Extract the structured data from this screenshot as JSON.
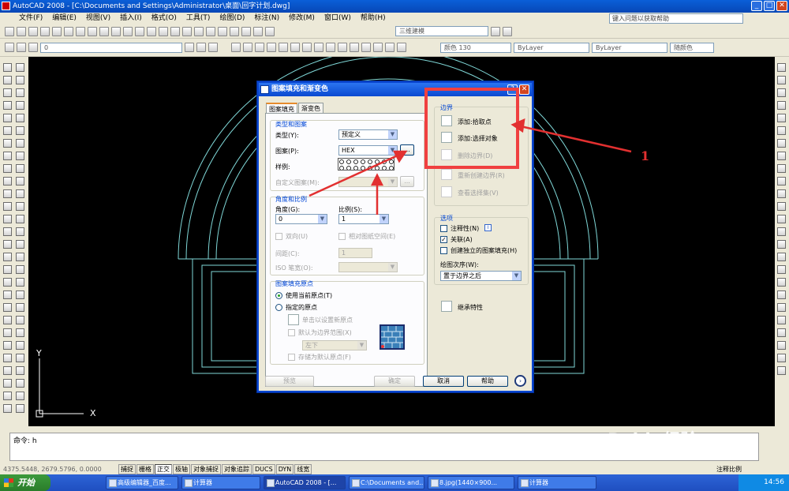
{
  "app": {
    "title": "AutoCAD 2008 - [C:\\Documents and Settings\\Administrator\\桌面\\回字计划.dwg]"
  },
  "menu": [
    "文件(F)",
    "编辑(E)",
    "视图(V)",
    "插入(I)",
    "格式(O)",
    "工具(T)",
    "绘图(D)",
    "标注(N)",
    "修改(M)",
    "窗口(W)",
    "帮助(H)"
  ],
  "help_search": {
    "placeholder": "键入问题以获取帮助"
  },
  "toolbar": {
    "workspace": "三维建模",
    "layer": "0",
    "color": "颜色 130",
    "linetype": "ByLayer",
    "lineweight": "ByLayer",
    "plotstyle": "随颜色"
  },
  "command": {
    "line": "命令: h"
  },
  "status": {
    "coords": "4375.5448, 2679.5796, 0.0000",
    "buttons": [
      "捕捉",
      "栅格",
      "正交",
      "极轴",
      "对象捕捉",
      "对象追踪",
      "DUCS",
      "DYN",
      "线宽"
    ],
    "on": [
      false,
      false,
      true,
      false,
      false,
      false,
      false,
      false,
      false
    ],
    "annotation_scale": "注释比例"
  },
  "ucs": {
    "x": "X",
    "y": "Y"
  },
  "taskbar": {
    "start": "开始",
    "tasks": [
      "高级编辑器_百度...",
      "计算器",
      "AutoCAD 2008 - [...",
      "C:\\Documents and...",
      "8.jpg(1440×900...",
      "计算器"
    ],
    "active_task": 2,
    "clock": "14:56"
  },
  "dialog": {
    "title": "图案填充和渐变色",
    "tabs": [
      "图案填充",
      "渐变色"
    ],
    "type_pattern": {
      "group": "类型和图案",
      "type_label": "类型(Y):",
      "type_value": "预定义",
      "pattern_label": "图案(P):",
      "pattern_value": "HEX",
      "swatch_label": "样例:",
      "custom_label": "自定义图案(M):"
    },
    "angle_scale": {
      "group": "角度和比例",
      "angle_label": "角度(G):",
      "angle_value": "0",
      "scale_label": "比例(S):",
      "scale_value": "1",
      "double_label": "双向(U)",
      "relative_label": "相对图纸空间(E)",
      "spacing_label": "间距(C):",
      "spacing_value": "1",
      "iso_label": "ISO 笔宽(O):"
    },
    "origin": {
      "group": "图案填充原点",
      "use_current": "使用当前原点(T)",
      "specified": "指定的原点",
      "click_set": "单击以设置新原点",
      "default_boundary": "默认为边界范围(X)",
      "position": "左下",
      "store_default": "存储为默认原点(F)"
    },
    "boundaries": {
      "group": "边界",
      "add_pick": "添加:拾取点",
      "add_select": "添加:选择对象",
      "remove": "删除边界(D)",
      "recreate": "重新创建边界(R)",
      "view_sel": "查看选择集(V)"
    },
    "options": {
      "group": "选项",
      "annotative": "注释性(N)",
      "annotative_checked": false,
      "associative": "关联(A)",
      "associative_checked": true,
      "separate": "创建独立的图案填充(H)",
      "separate_checked": false,
      "draw_order_label": "绘图次序(W):",
      "draw_order_value": "置于边界之后"
    },
    "inherit": "继承特性",
    "buttons": {
      "preview": "预览",
      "ok": "确定",
      "cancel": "取消",
      "help": "帮助"
    }
  },
  "annotation": {
    "callout": "1",
    "color": "#e23030"
  },
  "watermark": {
    "text": "Baidu经验",
    "url": "jingyan.baidu.com"
  },
  "colors": {
    "canvas": "#000000",
    "geometry": "#7fd7d7",
    "title_blue": "#0a49d0",
    "ui_bg": "#ece9d8"
  }
}
